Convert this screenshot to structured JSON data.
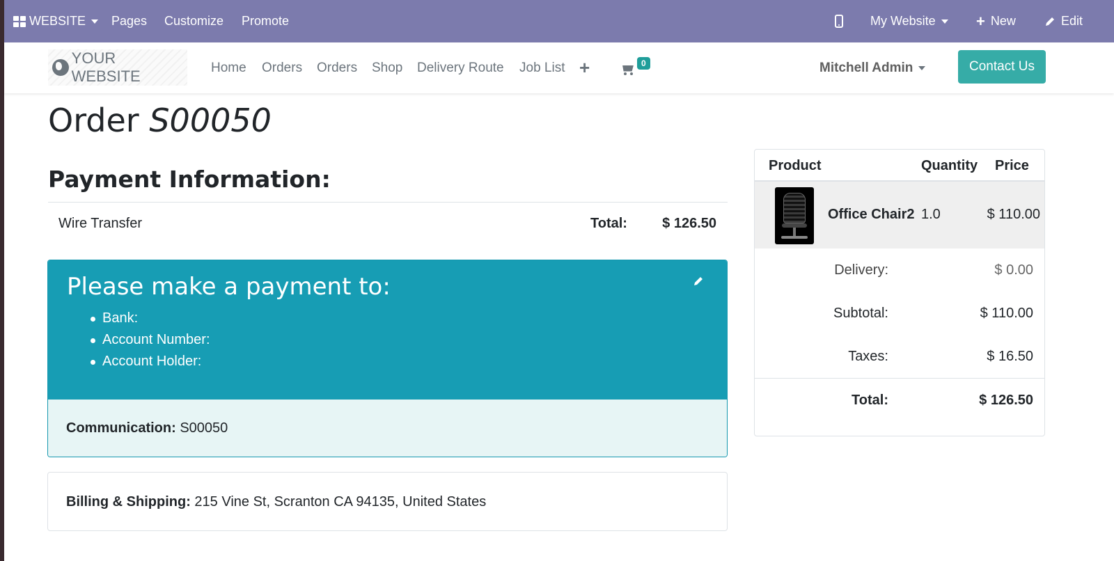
{
  "adminbar": {
    "app_label": "WEBSITE",
    "pages": "Pages",
    "customize": "Customize",
    "promote": "Promote",
    "my_website": "My Website",
    "new": "New",
    "edit": "Edit"
  },
  "header": {
    "logo": "YOUR WEBSITE",
    "nav": [
      "Home",
      "Orders",
      "Orders",
      "Shop",
      "Delivery Route",
      "Job List"
    ],
    "cart_count": "0",
    "user": "Mitchell Admin",
    "contact": "Contact Us"
  },
  "order": {
    "title_prefix": "Order",
    "number": "S00050"
  },
  "payment": {
    "heading": "Payment Information:",
    "method": "Wire Transfer",
    "total_label": "Total:",
    "total_value": "$ 126.50"
  },
  "alert": {
    "heading": "Please make a payment to:",
    "items": [
      "Bank:",
      "Account Number:",
      "Account Holder:"
    ],
    "communication_label": "Communication:",
    "communication_value": "S00050"
  },
  "billing": {
    "label": "Billing & Shipping:",
    "address": "215 Vine St, Scranton CA 94135, United States"
  },
  "summary": {
    "headers": {
      "product": "Product",
      "quantity": "Quantity",
      "price": "Price"
    },
    "line": {
      "name": "Office Chair2",
      "qty": "1.0",
      "price": "$ 110.00"
    },
    "delivery_label": "Delivery:",
    "delivery_value": "$ 0.00",
    "subtotal_label": "Subtotal:",
    "subtotal_value": "$ 110.00",
    "taxes_label": "Taxes:",
    "taxes_value": "$ 16.50",
    "total_label": "Total:",
    "total_value": "$ 126.50"
  },
  "colors": {
    "admin_bar": "#7c7bad",
    "primary": "#36aca7",
    "alert_bg": "#179db4",
    "alert_light": "#e7f5f5"
  }
}
